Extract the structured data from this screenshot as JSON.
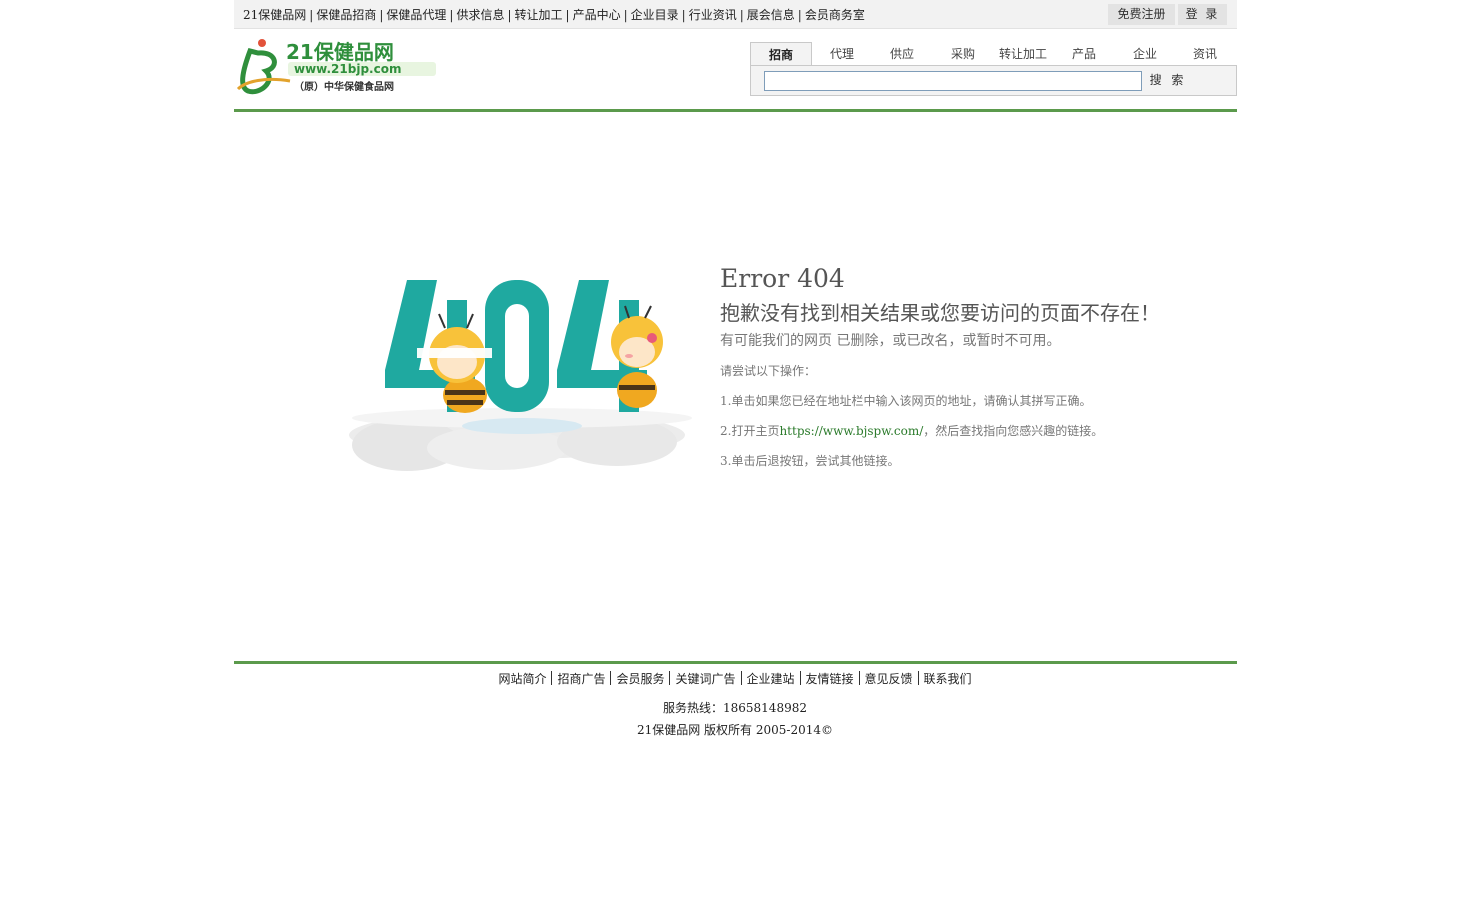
{
  "topbar": {
    "nav": [
      "21保健品网",
      "保健品招商",
      "保健品代理",
      "供求信息",
      "转让加工",
      "产品中心",
      "企业目录",
      "行业资讯",
      "展会信息",
      "会员商务室"
    ],
    "register_label": "免费注册",
    "login_label": "登 录"
  },
  "header": {
    "logo_text": "21保健品网",
    "logo_url": "www.21bjp.com",
    "logo_tagline": "（原）中华保健食品网",
    "tabs": [
      "招商",
      "代理",
      "供应",
      "采购",
      "转让加工",
      "产品",
      "企业",
      "资讯"
    ],
    "active_tab": "招商",
    "search_placeholder": "",
    "search_button": "搜 索"
  },
  "error": {
    "title": "Error 404",
    "subtitle": "抱歉没有找到相关结果或您要访问的页面不存在！",
    "note": "有可能我们的网页 已删除，或已改名，或暂时不可用。",
    "try_label": "请尝试以下操作：",
    "step1": "1.单击如果您已经在地址栏中输入该网页的地址，请确认其拼写正确。",
    "step2_prefix": "2.打开主页",
    "step2_link": "https://www.bjspw.com/",
    "step2_suffix": "，然后查找指向您感兴趣的链接。",
    "step3": "3.单击后退按钮，尝试其他链接。"
  },
  "footer": {
    "links": [
      "网站简介",
      "招商广告",
      "会员服务",
      "关键词广告",
      "企业建站",
      "友情链接",
      "意见反馈",
      "联系我们"
    ],
    "hotline": "服务热线：18658148982",
    "copyright": "21保健品网 版权所有 2005-2014©"
  },
  "colors": {
    "brand_green": "#5b9a4c",
    "teal_404": "#1fa9a0",
    "link_green": "#2a7a2a"
  }
}
